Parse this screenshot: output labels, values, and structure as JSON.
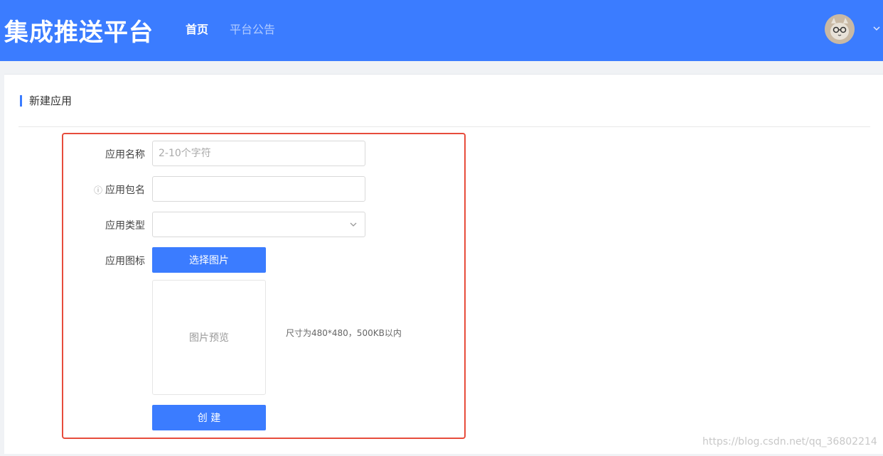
{
  "header": {
    "brand": "集成推送平台",
    "nav": [
      {
        "label": "首页",
        "active": true
      },
      {
        "label": "平台公告",
        "active": false
      }
    ]
  },
  "page": {
    "title": "新建应用"
  },
  "form": {
    "app_name": {
      "label": "应用名称",
      "placeholder": "2-10个字符",
      "value": ""
    },
    "package_name": {
      "label": "应用包名",
      "value": ""
    },
    "app_type": {
      "label": "应用类型",
      "value": ""
    },
    "app_icon": {
      "label": "应用图标",
      "button_label": "选择图片",
      "preview_label": "图片预览",
      "hint": "尺寸为480*480，500KB以内"
    },
    "create_label": "创 建"
  },
  "footer": {
    "watermark": "https://blog.csdn.net/qq_36802214"
  },
  "colors": {
    "accent": "#3b7cff",
    "highlight": "#e74c3c"
  },
  "icons": [
    "user-avatar",
    "chevron-down-icon",
    "info-icon"
  ]
}
